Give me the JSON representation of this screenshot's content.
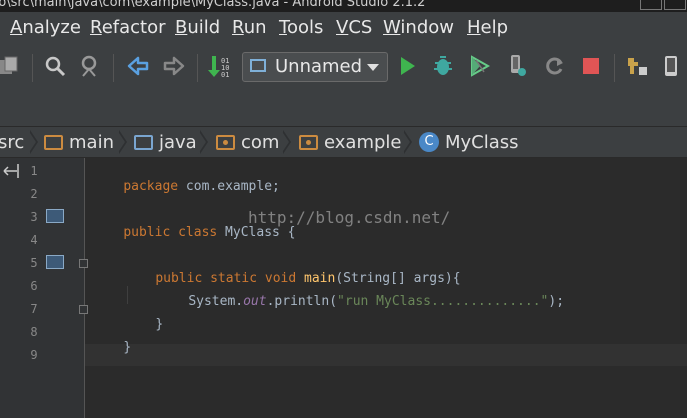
{
  "window": {
    "title": "b\\src\\main\\java\\com\\example\\MyClass.java - Android Studio 2.1.2"
  },
  "menu": {
    "items": [
      "Analyze",
      "Refactor",
      "Build",
      "Run",
      "Tools",
      "VCS",
      "Window",
      "Help"
    ]
  },
  "toolbar": {
    "run_configuration": "Unnamed",
    "icons": [
      "copy-icon",
      "find-icon",
      "replace-icon",
      "back-icon",
      "forward-icon",
      "make-project-icon",
      "run-icon",
      "debug-icon",
      "coverage-icon",
      "attach-debugger-icon",
      "rerun-icon",
      "stop-icon",
      "sdk-manager-icon",
      "avd-manager-icon"
    ]
  },
  "breadcrumb": {
    "items": [
      "src",
      "main",
      "java",
      "com",
      "example",
      "MyClass"
    ]
  },
  "editor": {
    "line_numbers": [
      "1",
      "2",
      "3",
      "4",
      "5",
      "6",
      "7",
      "8",
      "9"
    ],
    "code": {
      "l1_kw": "package",
      "l1_rest": " com.example;",
      "l3_kw": "public class",
      "l3_rest": " MyClass {",
      "l5_kw": "public static void",
      "l5_fn": " main",
      "l5_rest": "(String[] args){",
      "l6_pre": "System.",
      "l6_field": "out",
      "l6_mid": ".println(",
      "l6_str": "\"run MyClass..............\"",
      "l6_end": ");",
      "l7": "}",
      "l8": "}"
    },
    "watermark": "http://blog.csdn.net/"
  },
  "colors": {
    "keyword": "#cc7832",
    "string": "#6a8759",
    "field": "#9876aa",
    "function": "#ffc66d",
    "run_green": "#3fb54f",
    "stop_red": "#e05555"
  }
}
